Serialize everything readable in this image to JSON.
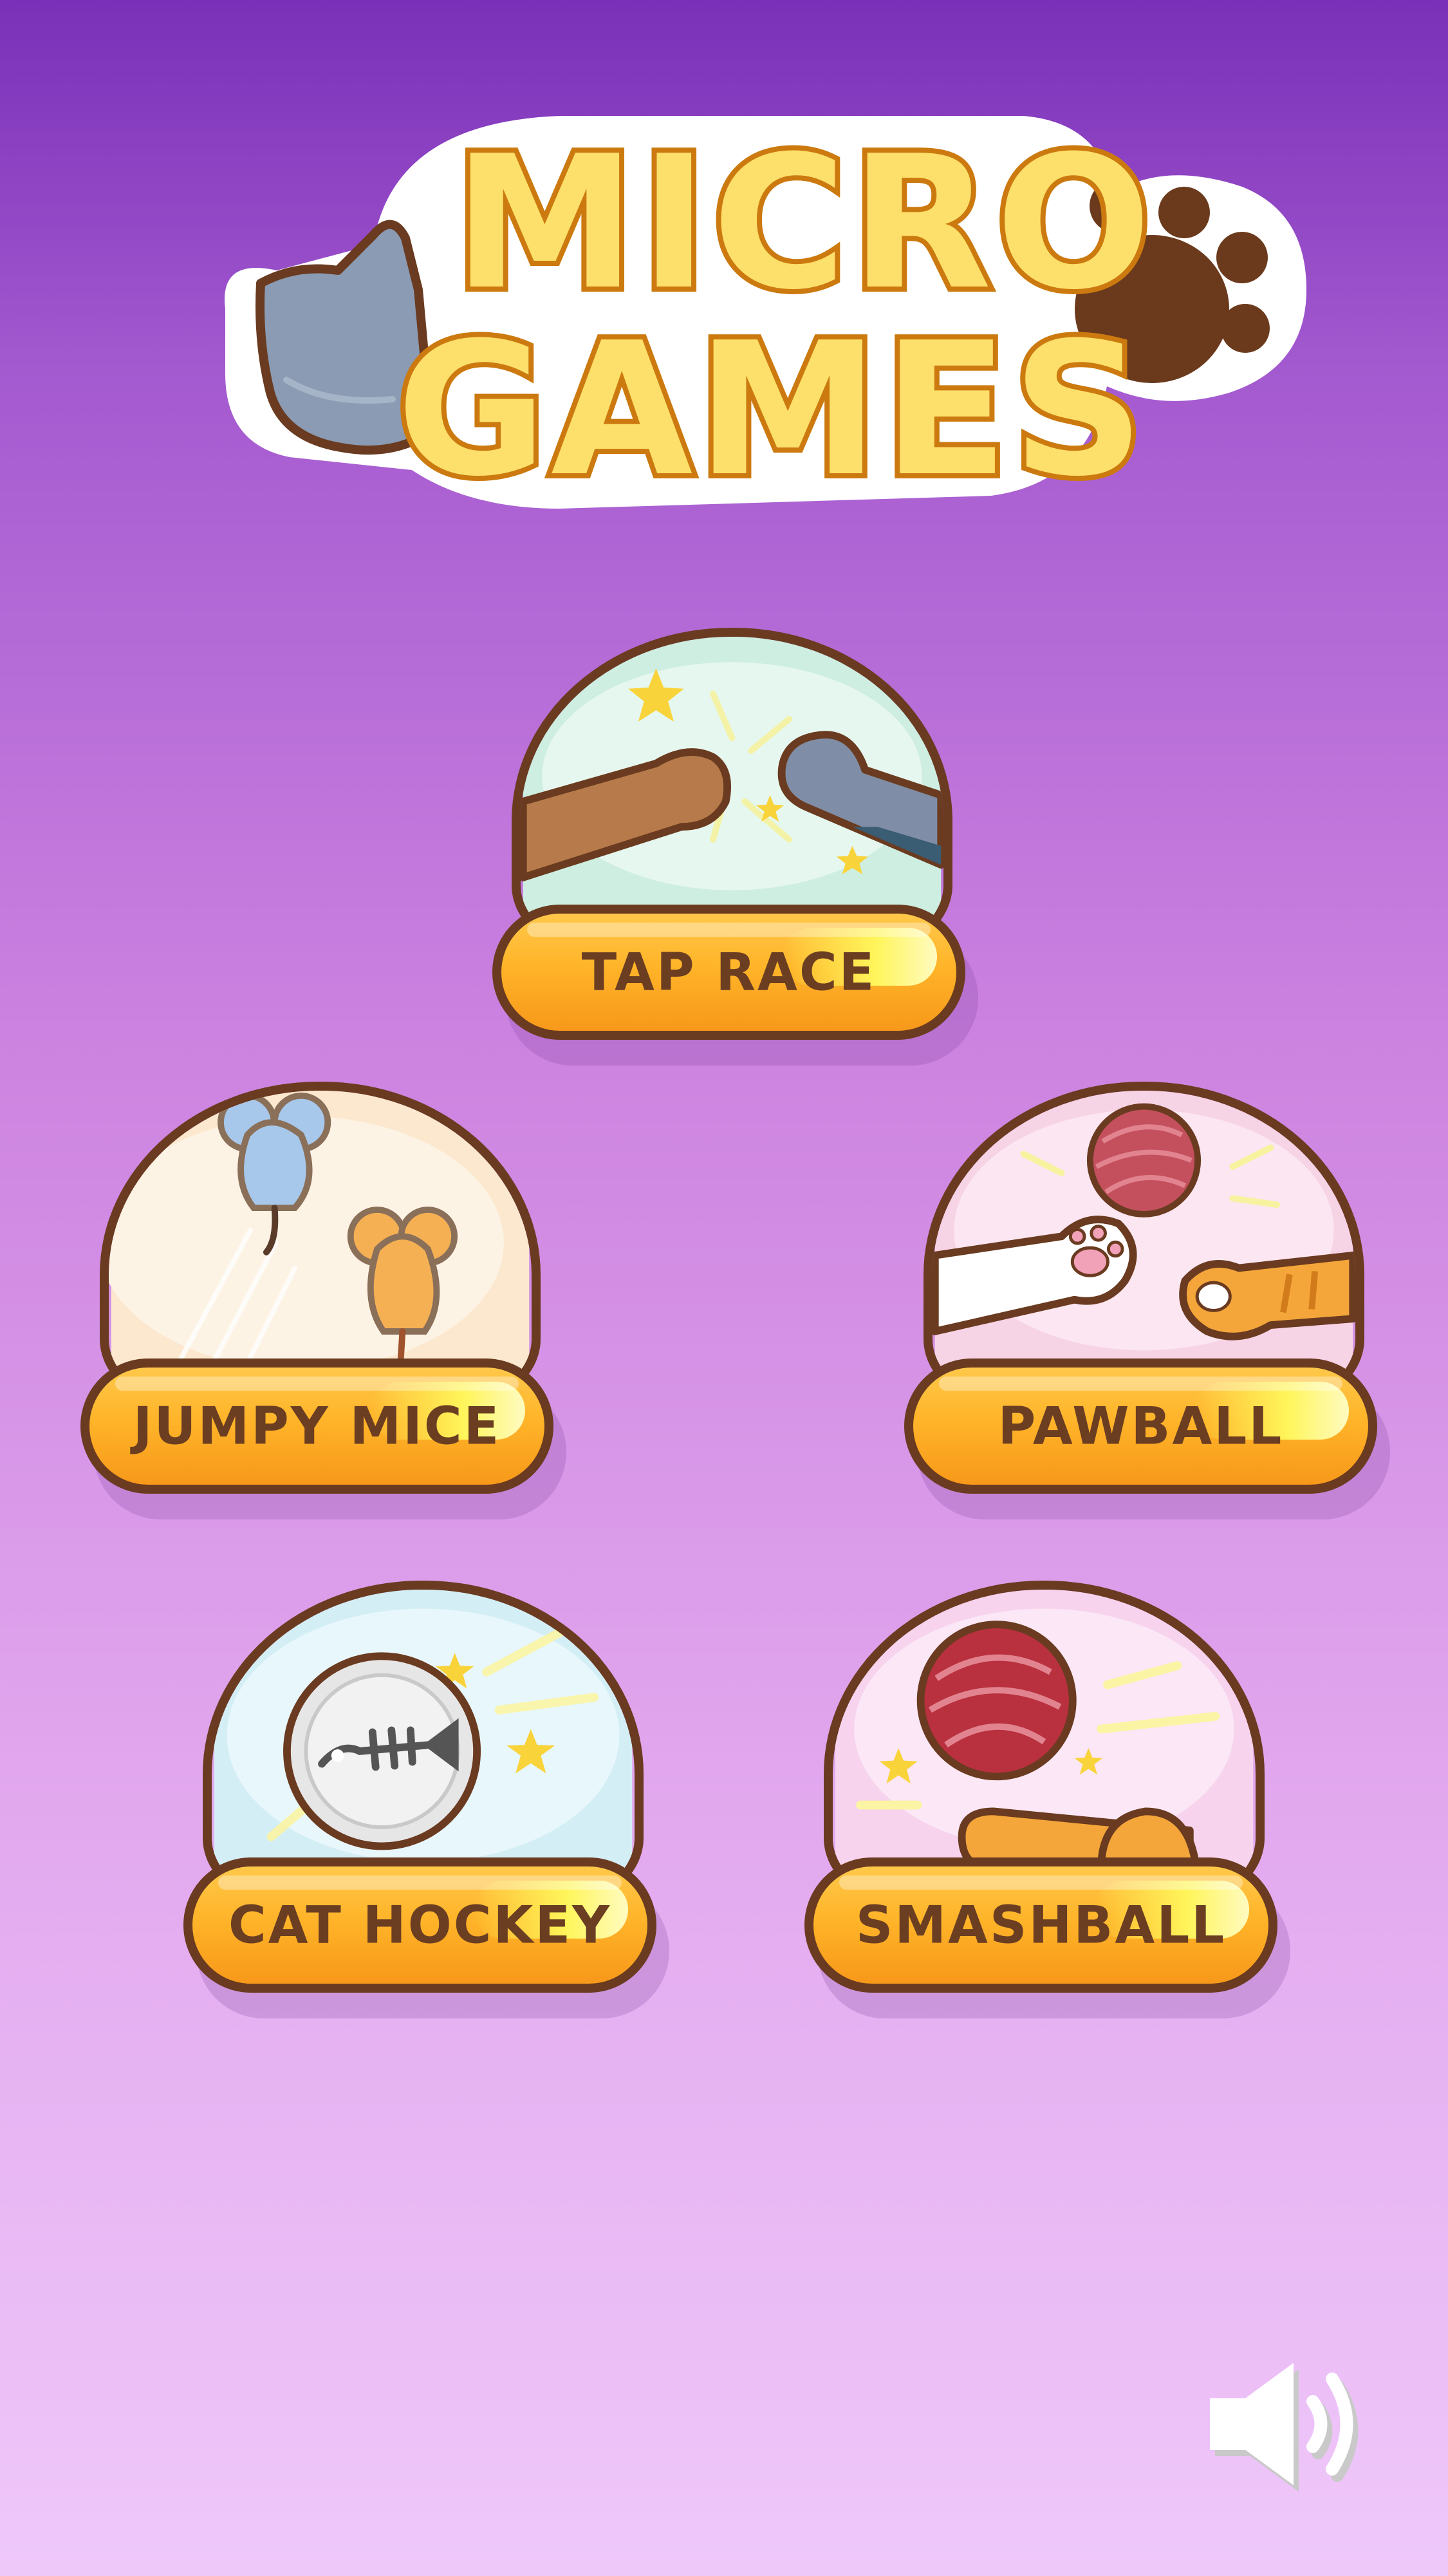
{
  "logo": {
    "line1": "MICRO",
    "line2": "GAMES",
    "icons": [
      "cat-head-icon",
      "paw-print-icon"
    ]
  },
  "games": [
    {
      "id": "tap-race",
      "label": "TAP RACE",
      "icon": "cat-paws-tapping-icon",
      "bg": "#cdeee0"
    },
    {
      "id": "jumpy-mice",
      "label": "JUMPY MICE",
      "icon": "mice-jumping-icon",
      "bg": "#fbe8cf"
    },
    {
      "id": "pawball",
      "label": "PAWBALL",
      "icon": "paws-and-yarn-ball-icon",
      "bg": "#f7d3e6"
    },
    {
      "id": "cat-hockey",
      "label": "CAT HOCKEY",
      "icon": "fishbone-puck-icon",
      "bg": "#d3eef5"
    },
    {
      "id": "smashball",
      "label": "SMASHBALL",
      "icon": "yarn-ball-and-bat-icon",
      "bg": "#f7d3ee"
    }
  ],
  "sound": {
    "icon": "speaker-volume-icon",
    "state": "on"
  },
  "colors": {
    "background_top": "#7a30b8",
    "background_bottom": "#efc8fa",
    "button_fill": "#ffb429",
    "outline": "#6a3b20",
    "logo_text": "#fde06c",
    "logo_outline": "#cc7a0f"
  }
}
